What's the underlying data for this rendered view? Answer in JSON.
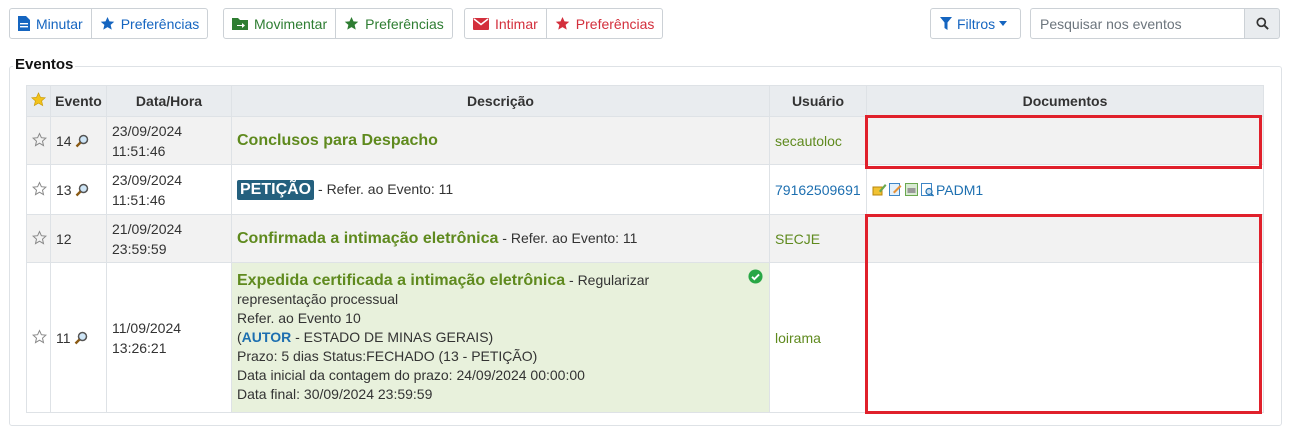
{
  "toolbar": {
    "minutar": "Minutar",
    "pref1": "Preferências",
    "movimentar": "Movimentar",
    "pref2": "Preferências",
    "intimar": "Intimar",
    "pref3": "Preferências",
    "filtros": "Filtros",
    "search_placeholder": "Pesquisar nos eventos"
  },
  "section_title": "Eventos",
  "table": {
    "headers": {
      "evento": "Evento",
      "datahora": "Data/Hora",
      "descricao": "Descrição",
      "usuario": "Usuário",
      "documentos": "Documentos"
    },
    "rows": [
      {
        "evento": "14",
        "date": "23/09/2024",
        "time": "11:51:46",
        "title": "Conclusos para Despacho",
        "usuario": "secautoloc"
      },
      {
        "evento": "13",
        "date": "23/09/2024",
        "time": "11:51:46",
        "badge": "PETIÇÃO",
        "ref": " - Refer. ao Evento: 11",
        "usuario": "79162509691",
        "doc": "PADM1"
      },
      {
        "evento": "12",
        "date": "21/09/2024",
        "time": "23:59:59",
        "title": "Confirmada a intimação eletrônica",
        "ref": " - Refer. ao Evento: 11",
        "usuario": "SECJE"
      },
      {
        "evento": "11",
        "date": "11/09/2024",
        "time": "13:26:21",
        "title": "Expedida certificada a intimação eletrônica",
        "detail1": " - Regularizar representação processual",
        "detail2": "Refer. ao Evento 10",
        "autor_open": "(",
        "autor": "AUTOR",
        "autor_rest": " - ESTADO DE MINAS GERAIS)",
        "prazo": "Prazo: 5 dias Status:FECHADO (13 - PETIÇÃO)",
        "inicio": "Data inicial da contagem do prazo: 24/09/2024 00:00:00",
        "final": "Data final: 30/09/2024 23:59:59",
        "usuario": "loirama"
      }
    ]
  },
  "colors": {
    "accent_blue": "#1565c0",
    "accent_green": "#2e7d32",
    "accent_red": "#d32f3c",
    "event_green": "#5f8a1e",
    "highlight_red": "#e0202b"
  }
}
